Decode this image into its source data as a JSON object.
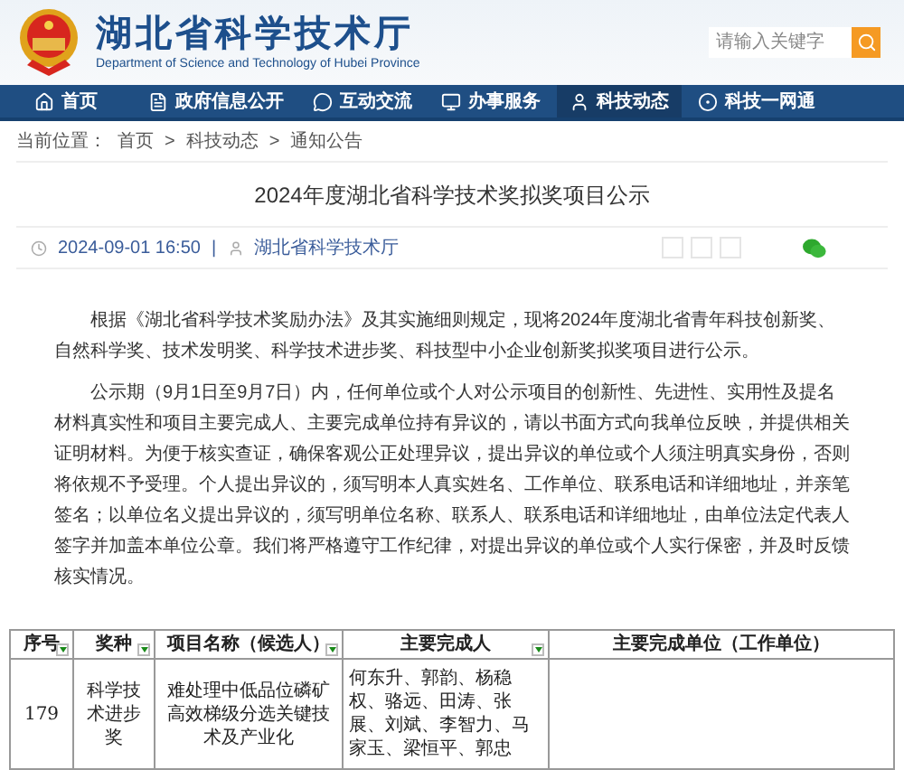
{
  "header": {
    "title": "湖北省科学技术厅",
    "subtitle": "Department of Science and Technology of Hubei Province",
    "search": {
      "placeholder": "请输入关键字"
    }
  },
  "nav": [
    {
      "label": "首页",
      "selected": false
    },
    {
      "label": "政府信息公开",
      "selected": false
    },
    {
      "label": "互动交流",
      "selected": false
    },
    {
      "label": "办事服务",
      "selected": false
    },
    {
      "label": "科技动态",
      "selected": true
    },
    {
      "label": "科技一网通",
      "selected": false
    }
  ],
  "breadcrumb": {
    "label": "当前位置：",
    "items": [
      "首页",
      "科技动态",
      "通知公告"
    ],
    "separator": ">"
  },
  "article": {
    "title": "2024年度湖北省科学技术奖拟奖项目公示",
    "date": "2024-09-01 16:50",
    "divider": "|",
    "source": "湖北省科学技术厅",
    "paragraphs": [
      "根据《湖北省科学技术奖励办法》及其实施细则规定，现将2024年度湖北省青年科技创新奖、自然科学奖、技术发明奖、科学技术进步奖、科技型中小企业创新奖拟奖项目进行公示。",
      "公示期（9月1日至9月7日）内，任何单位或个人对公示项目的创新性、先进性、实用性及提名材料真实性和项目主要完成人、主要完成单位持有异议的，请以书面方式向我单位反映，并提供相关证明材料。为便于核实查证，确保客观公正处理异议，提出异议的单位或个人须注明真实身份，否则将依规不予受理。个人提出异议的，须写明本人真实姓名、工作单位、联系电话和详细地址，并亲笔签名；以单位名义提出异议的，须写明单位名称、联系人、联系电话和详细地址，由单位法定代表人签字并加盖本单位公章。我们将严格遵守工作纪律，对提出异议的单位或个人实行保密，并及时反馈核实情况。"
    ]
  },
  "table": {
    "columns": [
      "序号",
      "奖种",
      "项目名称（候选人）",
      "主要完成人",
      "主要完成单位（工作单位）"
    ],
    "rows": [
      [
        "179",
        "科学技术进步奖",
        "难处理中低品位磷矿高效梯级分选关键技术及产业化",
        "何东升、郭韵、杨稳权、骆远、田涛、张展、刘斌、李智力、马家玉、梁恒平、郭忠"
      ]
    ]
  }
}
